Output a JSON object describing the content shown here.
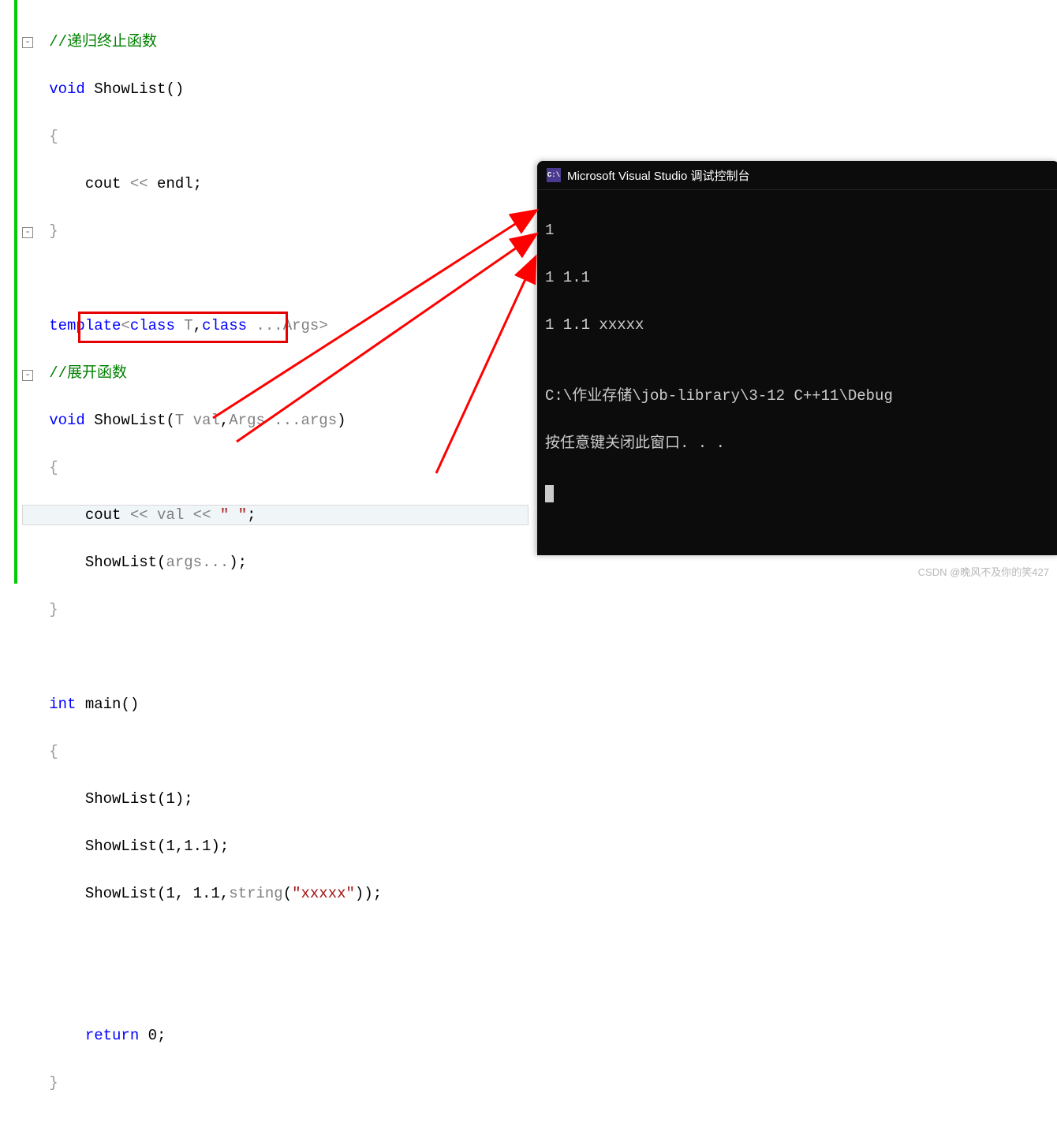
{
  "editor": {
    "comment1": "//递归终止函数",
    "line1_void": "void",
    "line1_fn": " ShowList()",
    "line3_cout": "cout",
    "line3_op": " << ",
    "line3_endl": "endl",
    "line3_semi": ";",
    "line5_template": "template",
    "line5_lt": "<",
    "line5_class1": "class",
    "line5_T": " T",
    "line5_comma": ",",
    "line5_class2": "class",
    "line5_dots": " ...",
    "line5_Args": "Args",
    "line5_gt": ">",
    "comment2": "//展开函数",
    "line7_void": "void",
    "line7_fn": " ShowList(",
    "line7_T": "T",
    "line7_val": " val",
    "line7_comma": ",",
    "line7_Args": "Args",
    "line7_dots": " ...",
    "line7_args": "args",
    "line7_rp": ")",
    "line9_cout": "cout ",
    "line9_op": "<<",
    "line9_val": " val ",
    "line9_op2": "<<",
    "line9_str": " \" \"",
    "line9_semi": ";",
    "line10_call": "ShowList(",
    "line10_args": "args",
    "line10_dots": "...",
    "line10_rp": ");",
    "line12_int": "int",
    "line12_main": " main()",
    "line14_a": "ShowList(1);",
    "line15_a": "ShowList(1,1.1);",
    "line16_a": "ShowList(1, 1.1,",
    "line16_string": "string",
    "line16_b": "(",
    "line16_str": "\"xxxxx\"",
    "line16_c": "));",
    "line18_return": "return",
    "line18_zero": " 0;"
  },
  "console": {
    "title": "Microsoft Visual Studio 调试控制台",
    "lines": [
      "1",
      "1 1.1",
      "1 1.1 xxxxx",
      "",
      "C:\\作业存储\\job-library\\3-12 C++11\\Debug",
      "按任意键关闭此窗口. . ."
    ]
  },
  "watermark": "CSDN @晚风不及你的笑427"
}
